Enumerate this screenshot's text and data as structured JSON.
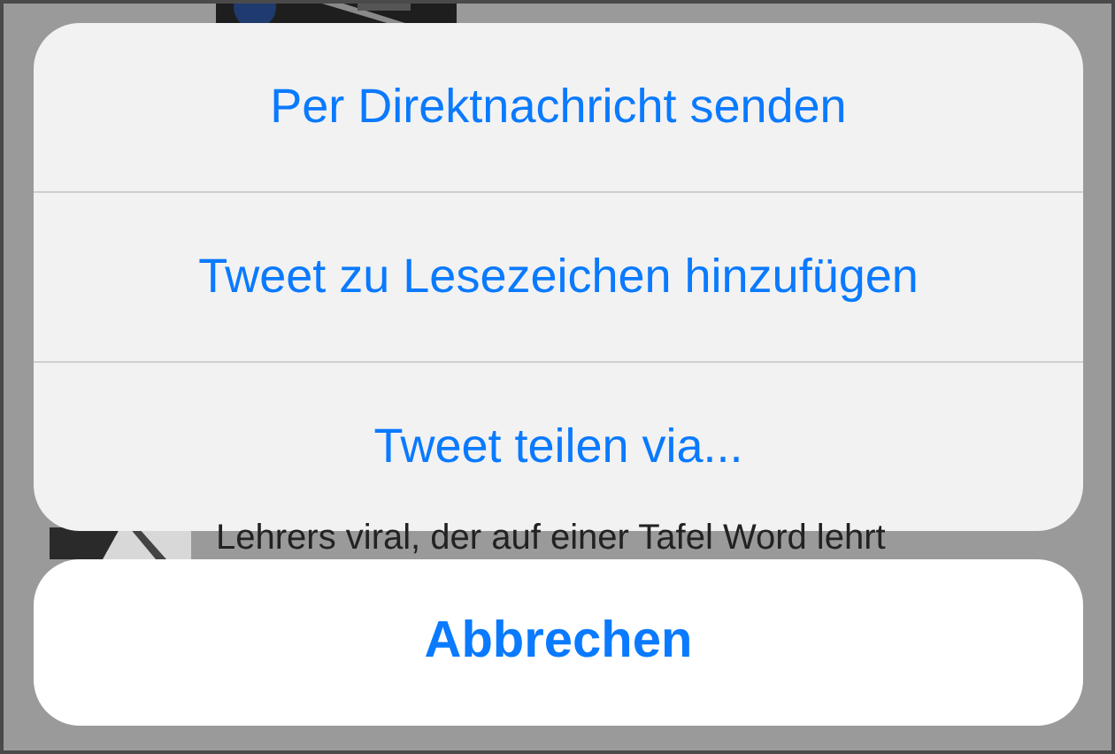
{
  "background": {
    "tweet_text": "Lehrers viral, der auf einer Tafel Word lehrt"
  },
  "action_sheet": {
    "actions": [
      {
        "label": "Per Direktnachricht senden"
      },
      {
        "label": "Tweet zu Lesezeichen hinzufügen"
      },
      {
        "label": "Tweet teilen via..."
      }
    ],
    "cancel": {
      "label": "Abbrechen"
    }
  }
}
